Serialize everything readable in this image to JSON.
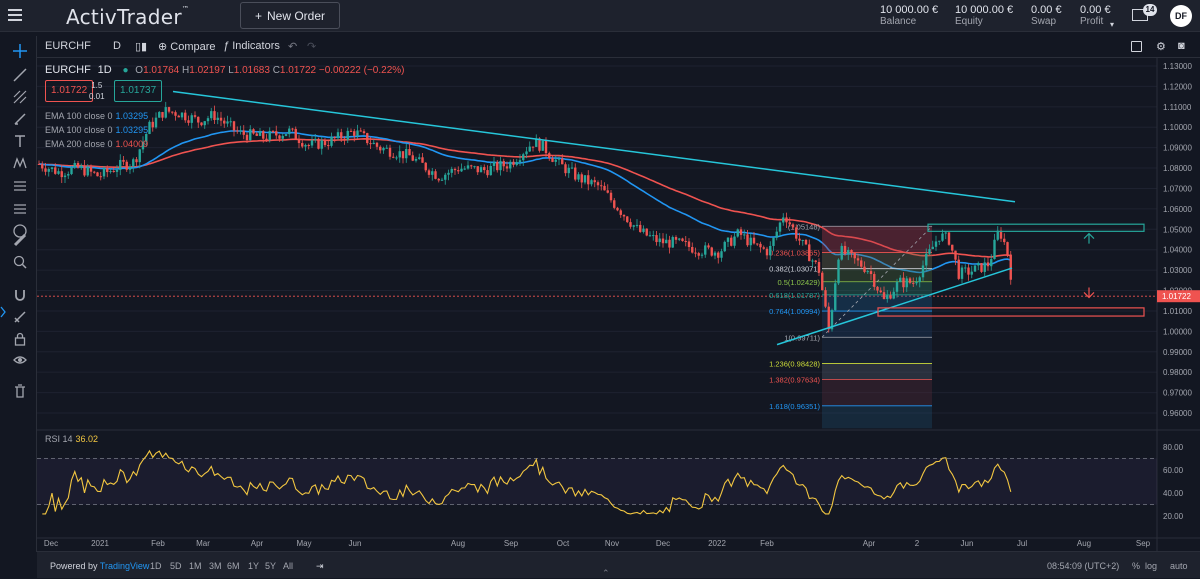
{
  "app": {
    "brand": "ActivTrader",
    "brand_mark": "™"
  },
  "header": {
    "new_order": "New Order",
    "stats": [
      {
        "value": "10 000.00 €",
        "label": "Balance"
      },
      {
        "value": "10 000.00 €",
        "label": "Equity"
      },
      {
        "value": "0.00 €",
        "label": "Swap"
      },
      {
        "value": "0.00 €",
        "label": "Profit"
      }
    ],
    "mail_count": "14",
    "avatar": "DF"
  },
  "toolbar": {
    "symbol": "EURCHF",
    "interval": "D",
    "compare": "Compare",
    "indicators": "Indicators"
  },
  "legend": {
    "symbol": "EURCHF",
    "interval": "1D",
    "o_label": "O",
    "o": "1.01764",
    "h_label": "H",
    "h": "1.02197",
    "l_label": "L",
    "l": "1.01683",
    "c_label": "C",
    "c": "1.01722",
    "change": "−0.00222 (−0.22%)",
    "sell_price": "1.01722",
    "buy_price": "1.01737",
    "spread_top": "1.5",
    "spread_bottom": "0.01",
    "ema": [
      {
        "label": "EMA 100 close 0",
        "value": "1.03295",
        "color": "#2196f3"
      },
      {
        "label": "EMA 100 close 0",
        "value": "1.03295",
        "color": "#2196f3"
      },
      {
        "label": "EMA 200 close 0",
        "value": "1.04009",
        "color": "#ef5350"
      }
    ]
  },
  "rsi": {
    "label": "RSI 14",
    "value": "36.02",
    "color": "#f3c741"
  },
  "price_axis": [
    "1.13000",
    "1.12000",
    "1.11000",
    "1.10000",
    "1.09000",
    "1.08000",
    "1.07000",
    "1.06000",
    "1.05000",
    "1.04000",
    "1.03000",
    "1.02000",
    "1.01000",
    "1.00000",
    "0.99000",
    "0.98000",
    "0.97000",
    "0.96000"
  ],
  "current_price": "1.01722",
  "rsi_axis": [
    "80.00",
    "60.00",
    "40.00",
    "20.00"
  ],
  "time_axis": [
    "Dec",
    "2021",
    "Feb",
    "Mar",
    "Apr",
    "May",
    "Jun",
    "Aug",
    "Sep",
    "Oct",
    "Nov",
    "Dec",
    "2022",
    "Feb",
    "Apr",
    "2",
    "Jun",
    "Jul",
    "Aug",
    "Sep"
  ],
  "fib_levels": [
    {
      "label": "(1.05148)",
      "color": "#a3a6af"
    },
    {
      "label": "0.236(1.03865)",
      "color": "#ef5350"
    },
    {
      "label": "0.382(1.03071)",
      "color": "#d1d4dc"
    },
    {
      "label": "0.5(1.02429)",
      "color": "#8bc34a"
    },
    {
      "label": "0.618(1.01787)",
      "color": "#26a69a"
    },
    {
      "label": "0.764(1.00994)",
      "color": "#2196f3"
    },
    {
      "label": "1(0.99711)",
      "color": "#a3a6af"
    },
    {
      "label": "1.236(0.98428)",
      "color": "#cddc39"
    },
    {
      "label": "1.382(0.97634)",
      "color": "#ef5350"
    },
    {
      "label": "1.618(0.96351)",
      "color": "#2196f3"
    }
  ],
  "bottom": {
    "powered_by": "Powered by",
    "tv": "TradingView",
    "ranges": [
      "1D",
      "5D",
      "1M",
      "3M",
      "6M",
      "1Y",
      "5Y",
      "All"
    ],
    "time": "08:54:09 (UTC+2)",
    "pct": "%",
    "log": "log",
    "auto": "auto"
  },
  "colors": {
    "up": "#26a69a",
    "down": "#ef5350",
    "ema100": "#2196f3",
    "ema200": "#ef5350",
    "trend": "#26c6da",
    "rsi": "#f3c741"
  }
}
